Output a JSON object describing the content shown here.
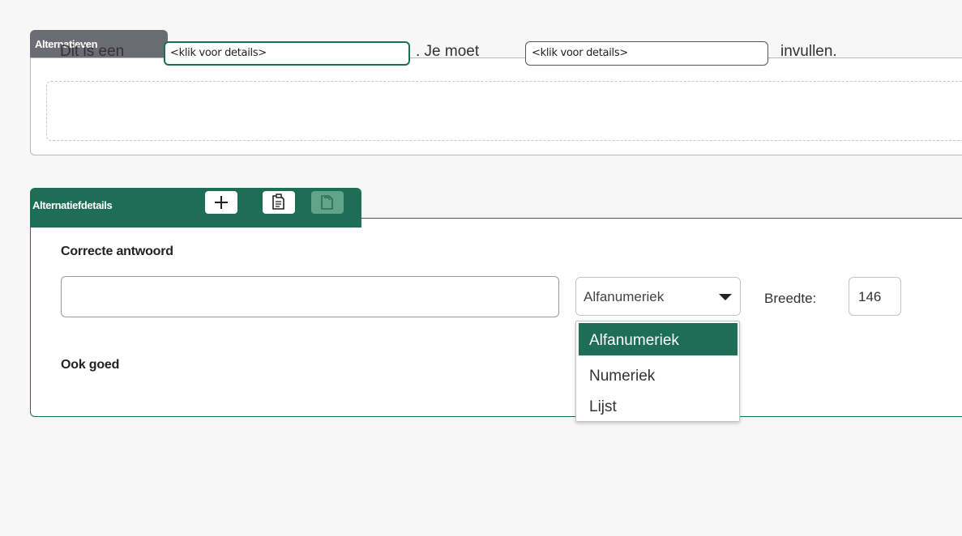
{
  "alternatives": {
    "tab_title": "Alternatieven",
    "sentence_part1": "Dit is een",
    "gap1_text": "<klik voor details>",
    "sentence_part2": ". Je moet",
    "gap2_text": "<klik voor details>",
    "sentence_part3": "invullen."
  },
  "details": {
    "tab_title": "Alternatiefdetails",
    "add_icon": "plus-icon",
    "copy_icon": "copy-icon",
    "paste_icon": "paste-icon",
    "correct_answer_label": "Correcte antwoord",
    "correct_answer_value": "",
    "type_select_value": "Alfanumeriek",
    "width_label": "Breedte:",
    "width_value": "146",
    "also_correct_label": "Ook goed",
    "type_options": [
      "Alfanumeriek",
      "Numeriek",
      "Lijst"
    ],
    "selected_option": "Alfanumeriek"
  },
  "colors": {
    "accent_green": "#1e6e56",
    "tab_grey": "#6b6b73"
  }
}
